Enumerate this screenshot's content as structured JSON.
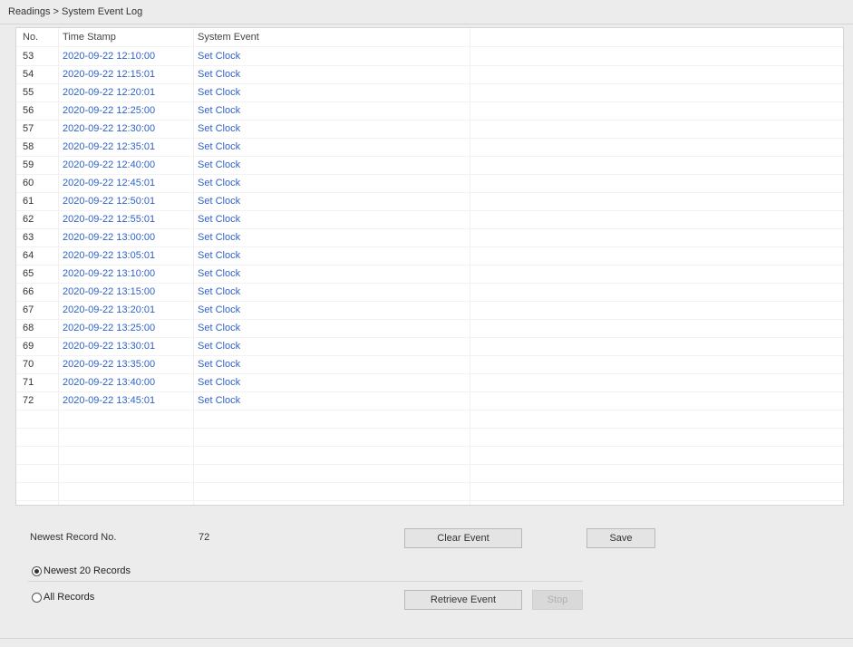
{
  "breadcrumb": "Readings > System Event Log",
  "table": {
    "headers": [
      "No.",
      "Time Stamp",
      "System Event"
    ],
    "rows": [
      {
        "no": "53",
        "time": "2020-09-22 12:10:00",
        "event": "Set Clock"
      },
      {
        "no": "54",
        "time": "2020-09-22 12:15:01",
        "event": "Set Clock"
      },
      {
        "no": "55",
        "time": "2020-09-22 12:20:01",
        "event": "Set Clock"
      },
      {
        "no": "56",
        "time": "2020-09-22 12:25:00",
        "event": "Set Clock"
      },
      {
        "no": "57",
        "time": "2020-09-22 12:30:00",
        "event": "Set Clock"
      },
      {
        "no": "58",
        "time": "2020-09-22 12:35:01",
        "event": "Set Clock"
      },
      {
        "no": "59",
        "time": "2020-09-22 12:40:00",
        "event": "Set Clock"
      },
      {
        "no": "60",
        "time": "2020-09-22 12:45:01",
        "event": "Set Clock"
      },
      {
        "no": "61",
        "time": "2020-09-22 12:50:01",
        "event": "Set Clock"
      },
      {
        "no": "62",
        "time": "2020-09-22 12:55:01",
        "event": "Set Clock"
      },
      {
        "no": "63",
        "time": "2020-09-22 13:00:00",
        "event": "Set Clock"
      },
      {
        "no": "64",
        "time": "2020-09-22 13:05:01",
        "event": "Set Clock"
      },
      {
        "no": "65",
        "time": "2020-09-22 13:10:00",
        "event": "Set Clock"
      },
      {
        "no": "66",
        "time": "2020-09-22 13:15:00",
        "event": "Set Clock"
      },
      {
        "no": "67",
        "time": "2020-09-22 13:20:01",
        "event": "Set Clock"
      },
      {
        "no": "68",
        "time": "2020-09-22 13:25:00",
        "event": "Set Clock"
      },
      {
        "no": "69",
        "time": "2020-09-22 13:30:01",
        "event": "Set Clock"
      },
      {
        "no": "70",
        "time": "2020-09-22 13:35:00",
        "event": "Set Clock"
      },
      {
        "no": "71",
        "time": "2020-09-22 13:40:00",
        "event": "Set Clock"
      },
      {
        "no": "72",
        "time": "2020-09-22 13:45:01",
        "event": "Set Clock"
      }
    ],
    "empty_rows": 5
  },
  "controls": {
    "newest_record_label": "Newest Record No.",
    "newest_record_value": "72",
    "clear_event_label": "Clear Event",
    "save_label": "Save",
    "radio_newest_label": "Newest 20 Records",
    "radio_all_label": "All Records",
    "radio_selected": "newest",
    "retrieve_event_label": "Retrieve Event",
    "stop_label": "Stop"
  },
  "colors": {
    "link_text": "#2f62c7"
  }
}
